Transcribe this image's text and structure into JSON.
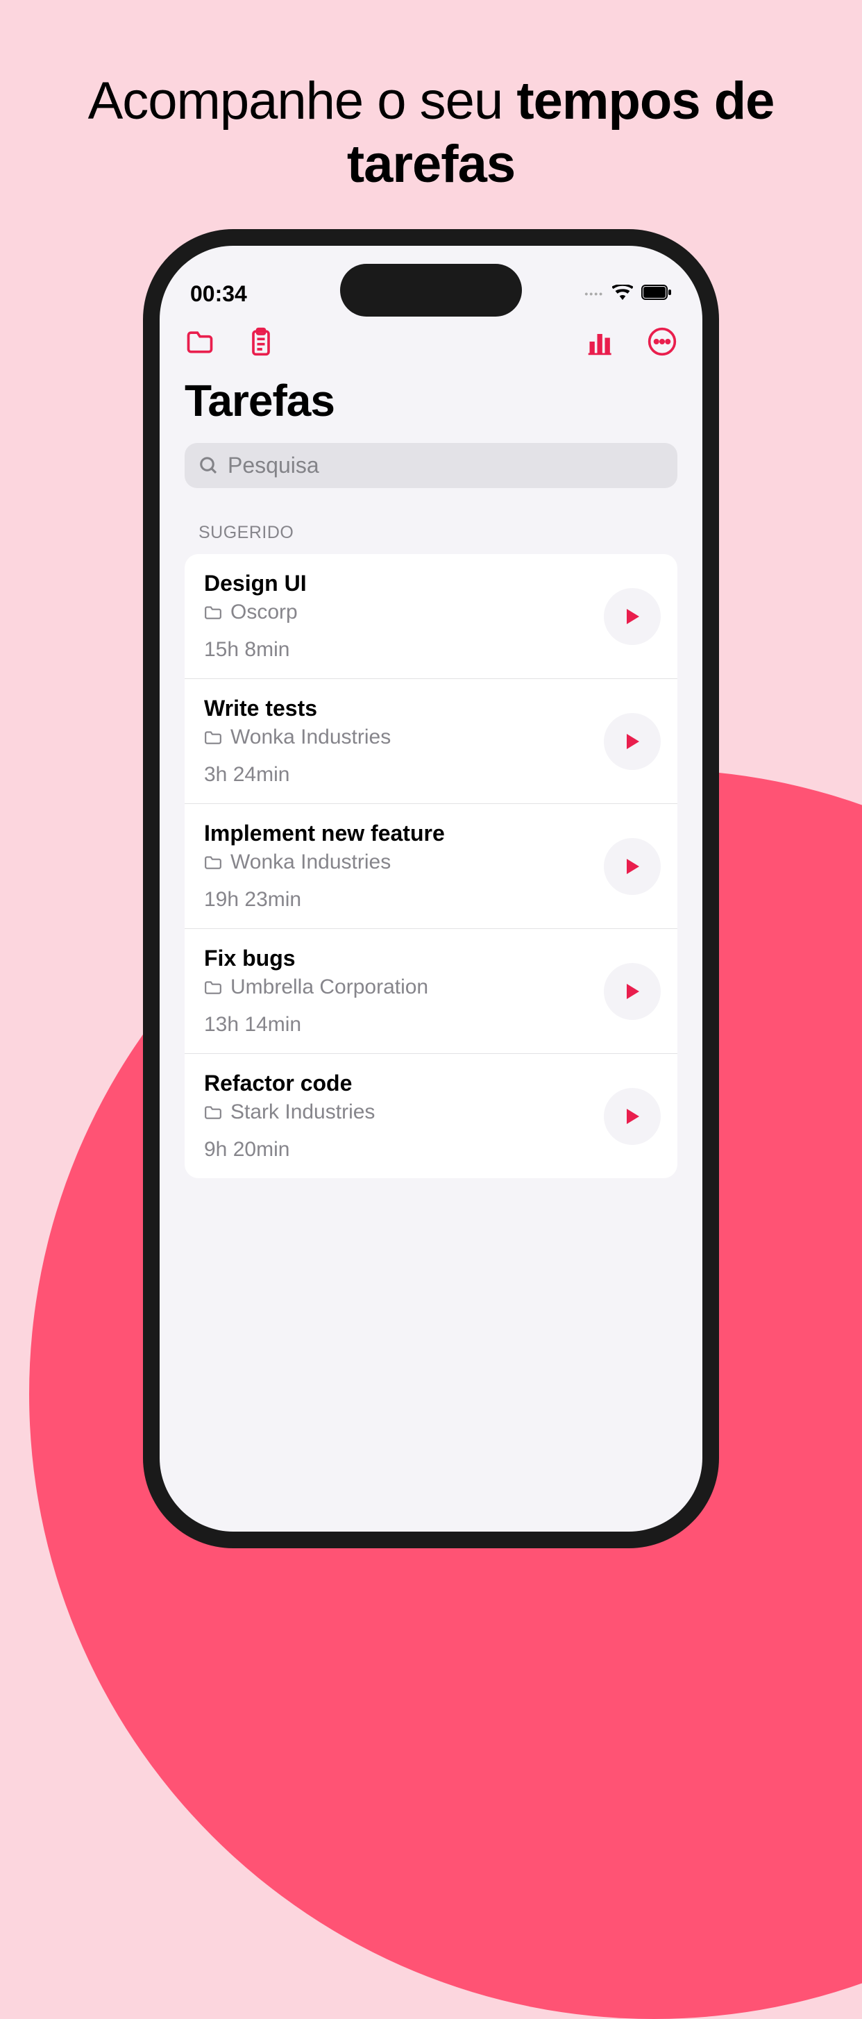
{
  "headline": {
    "part1": "Acompanhe o seu ",
    "part2": "tempos de tarefas"
  },
  "statusbar": {
    "time": "00:34"
  },
  "header": {
    "title": "Tarefas"
  },
  "search": {
    "placeholder": "Pesquisa"
  },
  "sections": [
    {
      "header": "SUGERIDO",
      "items": [
        {
          "title": "Design UI",
          "folder": "Oscorp",
          "time": "15h 8min"
        },
        {
          "title": "Write tests",
          "folder": "Wonka Industries",
          "time": "3h 24min"
        },
        {
          "title": "Implement new feature",
          "folder": "Wonka Industries",
          "time": "19h 23min"
        },
        {
          "title": "Fix bugs",
          "folder": "Umbrella Corporation",
          "time": "13h 14min"
        },
        {
          "title": "Refactor code",
          "folder": "Stark Industries",
          "time": "9h 20min"
        }
      ]
    }
  ]
}
